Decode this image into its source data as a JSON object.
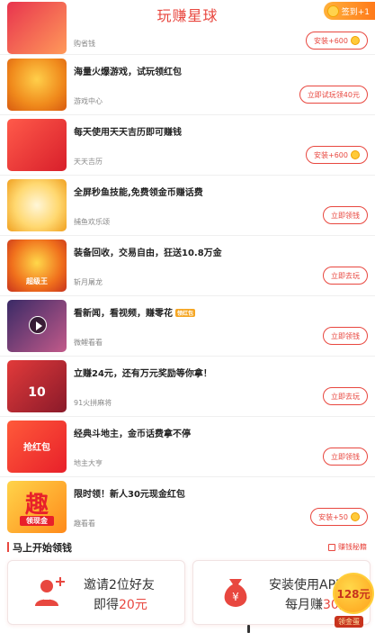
{
  "header": {
    "title": "玩赚星球",
    "checkin_label": "签到+1"
  },
  "rows": [
    {
      "title": "",
      "sub": "购省钱",
      "btn": "安装+600",
      "btn_coin": true,
      "thumb_label": ""
    },
    {
      "title": "海量火爆游戏，试玩领红包",
      "sub": "游戏中心",
      "btn": "立即试玩领40元",
      "btn_coin": false,
      "thumb_label": ""
    },
    {
      "title": "每天使用天天吉历即可赚钱",
      "sub": "天天吉历",
      "btn": "安装+600",
      "btn_coin": true,
      "thumb_label": ""
    },
    {
      "title": "全屏秒鱼技能,免费领金币赚话费",
      "sub": "捕鱼欢乐颂",
      "btn": "立即领钱",
      "btn_coin": false,
      "thumb_label": ""
    },
    {
      "title": "装备回收，交易自由，狂送10.8万金",
      "sub": "斩月屠龙",
      "btn": "立即去玩",
      "btn_coin": false,
      "thumb_label": "超级王"
    },
    {
      "title": "看新闻，看视频，赚零花",
      "badge": "领红包",
      "sub": "微鲤看看",
      "btn": "立即领钱",
      "btn_coin": false,
      "thumb_label": ""
    },
    {
      "title": "立赚24元，还有万元奖励等你拿！",
      "sub": "91火拼麻将",
      "btn": "立即去玩",
      "btn_coin": false,
      "thumb_label": "10"
    },
    {
      "title": "经典斗地主，金币话费拿不停",
      "sub": "地主大亨",
      "btn": "立即领钱",
      "btn_coin": false,
      "thumb_label": "抢红包"
    },
    {
      "title": "限时领！新人30元现金红包",
      "sub": "趣看看",
      "btn": "安装+50",
      "btn_coin": true,
      "thumb_label": "领现金",
      "thumb_big": "趣"
    }
  ],
  "section": {
    "title": "马上开始领钱",
    "link": "赚钱秘籍"
  },
  "cards": {
    "left": {
      "line1": "邀请2位好友",
      "line2_prefix": "即得",
      "line2_amount": "20元"
    },
    "right": {
      "line1": "安装使用APP",
      "line2_prefix": "每月赚",
      "line2_amount": "30元"
    }
  },
  "float": {
    "amount": "128元",
    "label": "领金蛋"
  },
  "colors": {
    "accent": "#e8473f",
    "coin": "#ffca3a"
  }
}
